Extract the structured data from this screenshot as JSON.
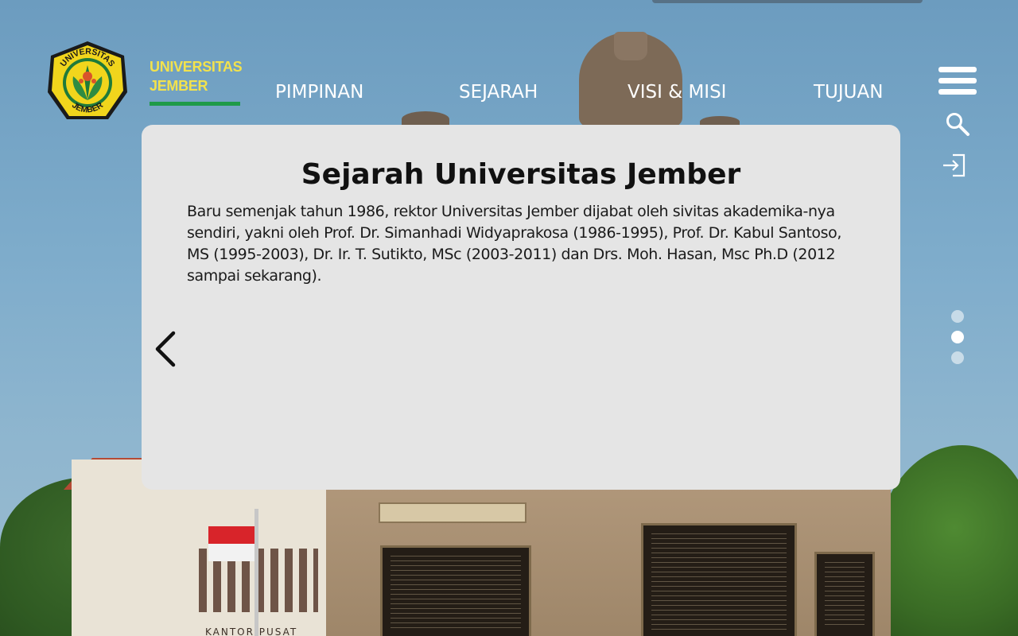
{
  "brand": {
    "line1": "UNIVERSITAS",
    "line2": "JEMBER",
    "logo_top_text": "UNIVERSITAS",
    "logo_bottom_text": "JEMBER",
    "accent_yellow": "#f2e24d",
    "accent_green": "#1f9a48"
  },
  "nav": {
    "items": [
      {
        "label": "PIMPINAN"
      },
      {
        "label": "SEJARAH"
      },
      {
        "label": "VISI & MISI"
      },
      {
        "label": "TUJUAN"
      }
    ]
  },
  "side_icons": [
    "hamburger-menu-icon",
    "search-icon",
    "login-icon"
  ],
  "card": {
    "title": "Sejarah Universitas Jember",
    "body": "Baru semenjak tahun 1986, rektor Universitas Jember dijabat oleh sivitas akademika-nya sendiri, yakni oleh Prof. Dr. Simanhadi Widyaprakosa (1986-1995), Prof. Dr. Kabul Santoso, MS (1995-2003), Dr. Ir. T. Sutikto, MSc (2003-2011) dan Drs. Moh. Hasan, Msc Ph.D (2012 sampai sekarang).",
    "prev_icon": "chevron-left-icon"
  },
  "pagination": {
    "count": 3,
    "active_index": 1
  },
  "background": {
    "building_sign": "KANTOR PUSAT"
  }
}
